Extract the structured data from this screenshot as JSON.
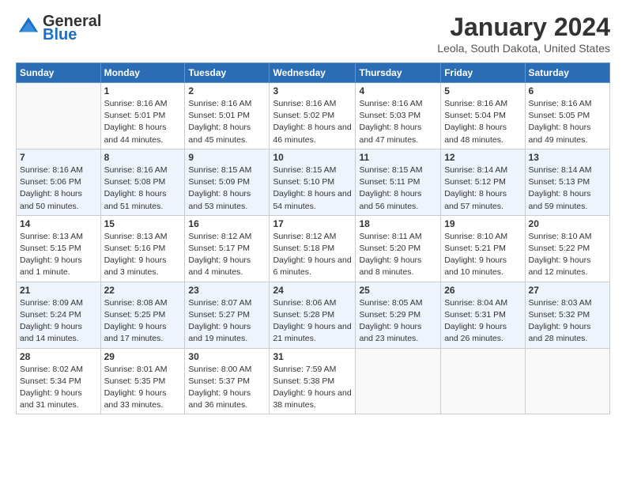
{
  "logo": {
    "general": "General",
    "blue": "Blue"
  },
  "header": {
    "month": "January 2024",
    "location": "Leola, South Dakota, United States"
  },
  "weekdays": [
    "Sunday",
    "Monday",
    "Tuesday",
    "Wednesday",
    "Thursday",
    "Friday",
    "Saturday"
  ],
  "weeks": [
    [
      {
        "day": "",
        "sunrise": "",
        "sunset": "",
        "daylight": ""
      },
      {
        "day": "1",
        "sunrise": "Sunrise: 8:16 AM",
        "sunset": "Sunset: 5:01 PM",
        "daylight": "Daylight: 8 hours and 44 minutes."
      },
      {
        "day": "2",
        "sunrise": "Sunrise: 8:16 AM",
        "sunset": "Sunset: 5:01 PM",
        "daylight": "Daylight: 8 hours and 45 minutes."
      },
      {
        "day": "3",
        "sunrise": "Sunrise: 8:16 AM",
        "sunset": "Sunset: 5:02 PM",
        "daylight": "Daylight: 8 hours and 46 minutes."
      },
      {
        "day": "4",
        "sunrise": "Sunrise: 8:16 AM",
        "sunset": "Sunset: 5:03 PM",
        "daylight": "Daylight: 8 hours and 47 minutes."
      },
      {
        "day": "5",
        "sunrise": "Sunrise: 8:16 AM",
        "sunset": "Sunset: 5:04 PM",
        "daylight": "Daylight: 8 hours and 48 minutes."
      },
      {
        "day": "6",
        "sunrise": "Sunrise: 8:16 AM",
        "sunset": "Sunset: 5:05 PM",
        "daylight": "Daylight: 8 hours and 49 minutes."
      }
    ],
    [
      {
        "day": "7",
        "sunrise": "Sunrise: 8:16 AM",
        "sunset": "Sunset: 5:06 PM",
        "daylight": "Daylight: 8 hours and 50 minutes."
      },
      {
        "day": "8",
        "sunrise": "Sunrise: 8:16 AM",
        "sunset": "Sunset: 5:08 PM",
        "daylight": "Daylight: 8 hours and 51 minutes."
      },
      {
        "day": "9",
        "sunrise": "Sunrise: 8:15 AM",
        "sunset": "Sunset: 5:09 PM",
        "daylight": "Daylight: 8 hours and 53 minutes."
      },
      {
        "day": "10",
        "sunrise": "Sunrise: 8:15 AM",
        "sunset": "Sunset: 5:10 PM",
        "daylight": "Daylight: 8 hours and 54 minutes."
      },
      {
        "day": "11",
        "sunrise": "Sunrise: 8:15 AM",
        "sunset": "Sunset: 5:11 PM",
        "daylight": "Daylight: 8 hours and 56 minutes."
      },
      {
        "day": "12",
        "sunrise": "Sunrise: 8:14 AM",
        "sunset": "Sunset: 5:12 PM",
        "daylight": "Daylight: 8 hours and 57 minutes."
      },
      {
        "day": "13",
        "sunrise": "Sunrise: 8:14 AM",
        "sunset": "Sunset: 5:13 PM",
        "daylight": "Daylight: 8 hours and 59 minutes."
      }
    ],
    [
      {
        "day": "14",
        "sunrise": "Sunrise: 8:13 AM",
        "sunset": "Sunset: 5:15 PM",
        "daylight": "Daylight: 9 hours and 1 minute."
      },
      {
        "day": "15",
        "sunrise": "Sunrise: 8:13 AM",
        "sunset": "Sunset: 5:16 PM",
        "daylight": "Daylight: 9 hours and 3 minutes."
      },
      {
        "day": "16",
        "sunrise": "Sunrise: 8:12 AM",
        "sunset": "Sunset: 5:17 PM",
        "daylight": "Daylight: 9 hours and 4 minutes."
      },
      {
        "day": "17",
        "sunrise": "Sunrise: 8:12 AM",
        "sunset": "Sunset: 5:18 PM",
        "daylight": "Daylight: 9 hours and 6 minutes."
      },
      {
        "day": "18",
        "sunrise": "Sunrise: 8:11 AM",
        "sunset": "Sunset: 5:20 PM",
        "daylight": "Daylight: 9 hours and 8 minutes."
      },
      {
        "day": "19",
        "sunrise": "Sunrise: 8:10 AM",
        "sunset": "Sunset: 5:21 PM",
        "daylight": "Daylight: 9 hours and 10 minutes."
      },
      {
        "day": "20",
        "sunrise": "Sunrise: 8:10 AM",
        "sunset": "Sunset: 5:22 PM",
        "daylight": "Daylight: 9 hours and 12 minutes."
      }
    ],
    [
      {
        "day": "21",
        "sunrise": "Sunrise: 8:09 AM",
        "sunset": "Sunset: 5:24 PM",
        "daylight": "Daylight: 9 hours and 14 minutes."
      },
      {
        "day": "22",
        "sunrise": "Sunrise: 8:08 AM",
        "sunset": "Sunset: 5:25 PM",
        "daylight": "Daylight: 9 hours and 17 minutes."
      },
      {
        "day": "23",
        "sunrise": "Sunrise: 8:07 AM",
        "sunset": "Sunset: 5:27 PM",
        "daylight": "Daylight: 9 hours and 19 minutes."
      },
      {
        "day": "24",
        "sunrise": "Sunrise: 8:06 AM",
        "sunset": "Sunset: 5:28 PM",
        "daylight": "Daylight: 9 hours and 21 minutes."
      },
      {
        "day": "25",
        "sunrise": "Sunrise: 8:05 AM",
        "sunset": "Sunset: 5:29 PM",
        "daylight": "Daylight: 9 hours and 23 minutes."
      },
      {
        "day": "26",
        "sunrise": "Sunrise: 8:04 AM",
        "sunset": "Sunset: 5:31 PM",
        "daylight": "Daylight: 9 hours and 26 minutes."
      },
      {
        "day": "27",
        "sunrise": "Sunrise: 8:03 AM",
        "sunset": "Sunset: 5:32 PM",
        "daylight": "Daylight: 9 hours and 28 minutes."
      }
    ],
    [
      {
        "day": "28",
        "sunrise": "Sunrise: 8:02 AM",
        "sunset": "Sunset: 5:34 PM",
        "daylight": "Daylight: 9 hours and 31 minutes."
      },
      {
        "day": "29",
        "sunrise": "Sunrise: 8:01 AM",
        "sunset": "Sunset: 5:35 PM",
        "daylight": "Daylight: 9 hours and 33 minutes."
      },
      {
        "day": "30",
        "sunrise": "Sunrise: 8:00 AM",
        "sunset": "Sunset: 5:37 PM",
        "daylight": "Daylight: 9 hours and 36 minutes."
      },
      {
        "day": "31",
        "sunrise": "Sunrise: 7:59 AM",
        "sunset": "Sunset: 5:38 PM",
        "daylight": "Daylight: 9 hours and 38 minutes."
      },
      {
        "day": "",
        "sunrise": "",
        "sunset": "",
        "daylight": ""
      },
      {
        "day": "",
        "sunrise": "",
        "sunset": "",
        "daylight": ""
      },
      {
        "day": "",
        "sunrise": "",
        "sunset": "",
        "daylight": ""
      }
    ]
  ]
}
